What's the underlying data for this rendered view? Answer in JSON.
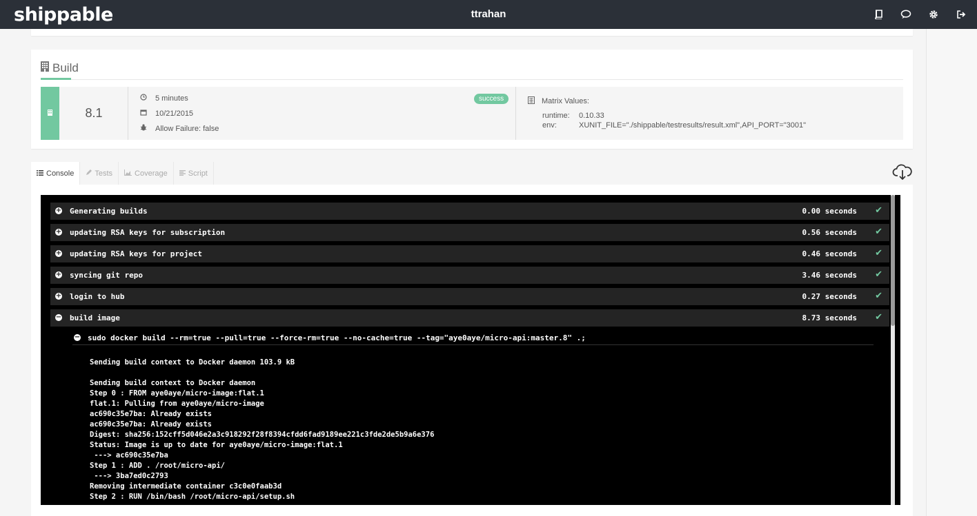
{
  "header": {
    "logo": "shippable",
    "title": "ttrahan",
    "icons": [
      "book-icon",
      "chat-icon",
      "gear-icon",
      "sign-out-icon"
    ]
  },
  "build": {
    "title": "Build",
    "number": "8.1",
    "duration": "5 minutes",
    "date": "10/21/2015",
    "allow_failure": "Allow Failure: false",
    "status": "success",
    "status_color": "#72c8a0",
    "matrix": {
      "title": "Matrix Values:",
      "runtime_key": "runtime:",
      "runtime_value": "0.10.33",
      "env_key": "env:",
      "env_value": "XUNIT_FILE=\"./shippable/testresults/result.xml\",API_PORT=\"3001\""
    }
  },
  "tabs": [
    {
      "label": "Console",
      "active": true
    },
    {
      "label": "Tests",
      "active": false
    },
    {
      "label": "Coverage",
      "active": false
    },
    {
      "label": "Script",
      "active": false
    }
  ],
  "console": {
    "sections": [
      {
        "label": "Generating builds",
        "duration": "0.00 seconds",
        "expanded": false
      },
      {
        "label": "updating RSA keys for subscription",
        "duration": "0.56 seconds",
        "expanded": false
      },
      {
        "label": "updating RSA keys for project",
        "duration": "0.46 seconds",
        "expanded": false
      },
      {
        "label": "syncing git repo",
        "duration": "3.46 seconds",
        "expanded": false
      },
      {
        "label": "login to hub",
        "duration": "0.27 seconds",
        "expanded": false
      },
      {
        "label": "build image",
        "duration": "8.73 seconds",
        "expanded": true
      }
    ],
    "command": "sudo docker build --rm=true --pull=true --force-rm=true --no-cache=true --tag=\"aye0aye/micro-api:master.8\" .;",
    "output": [
      "Sending build context to Docker daemon 103.9 kB",
      "",
      "Sending build context to Docker daemon",
      "Step 0 : FROM aye0aye/micro-image:flat.1",
      "flat.1: Pulling from aye0aye/micro-image",
      "ac690c35e7ba: Already exists",
      "ac690c35e7ba: Already exists",
      "Digest: sha256:152cff5d046e2a3c918292f28f8394cfdd6fad9189ee221c3fde2de5b9a6e376",
      "Status: Image is up to date for aye0aye/micro-image:flat.1",
      " ---> ac690c35e7ba",
      "Step 1 : ADD . /root/micro-api/",
      " ---> 3ba7ed0c2793",
      "Removing intermediate container c3c0e0faab3d",
      "Step 2 : RUN /bin/bash /root/micro-api/setup.sh"
    ]
  }
}
